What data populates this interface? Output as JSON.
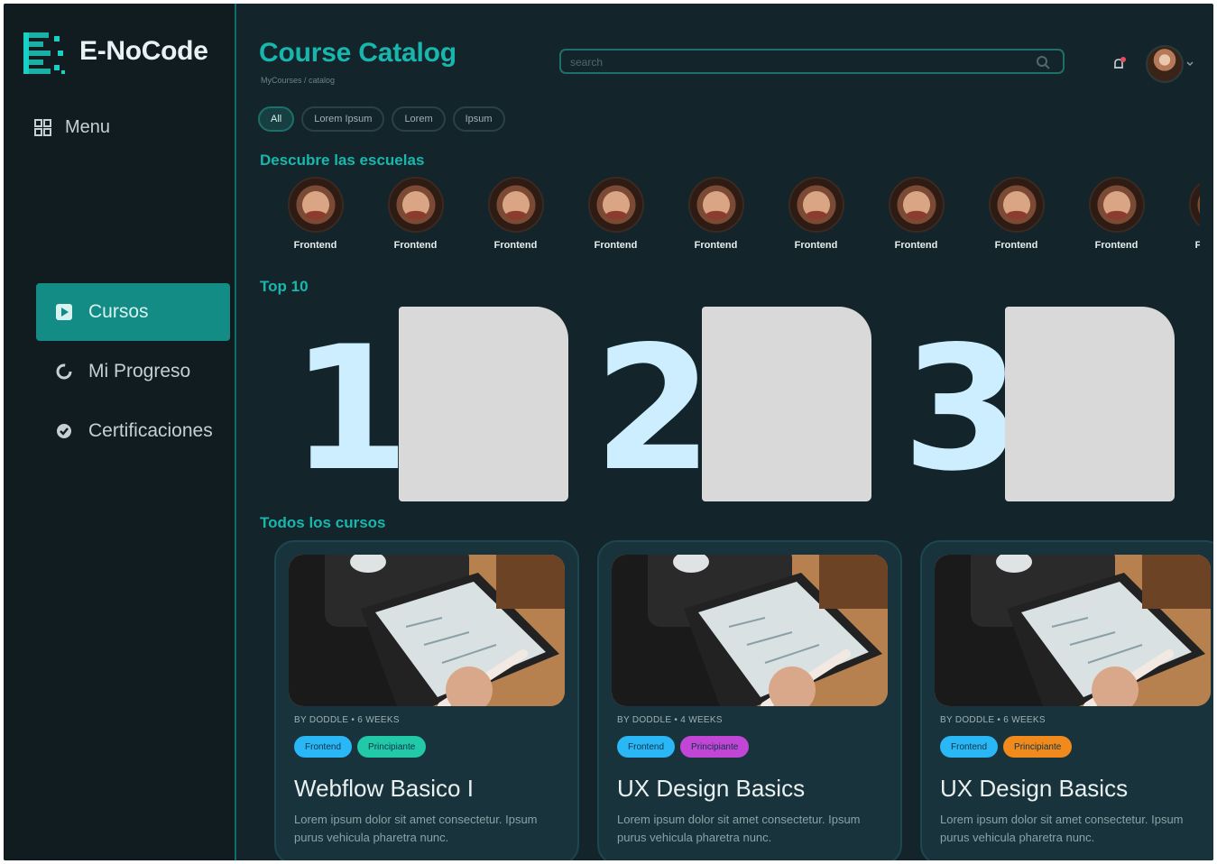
{
  "app": {
    "name": "E-NoCode"
  },
  "sidebar": {
    "menu_label": "Menu",
    "items": [
      {
        "label": "Cursos",
        "icon": "play-square-icon",
        "active": true
      },
      {
        "label": "Mi Progreso",
        "icon": "progress-circle-icon",
        "active": false
      },
      {
        "label": "Certificaciones",
        "icon": "badge-check-icon",
        "active": false
      }
    ]
  },
  "header": {
    "title": "Course Catalog",
    "breadcrumb": "MyCourses / catalog",
    "search_placeholder": "search"
  },
  "filters": [
    "All",
    "Lorem Ipsum",
    "Lorem",
    "Ipsum"
  ],
  "schools": {
    "title": "Descubre las escuelas",
    "items": [
      "Frontend",
      "Frontend",
      "Frontend",
      "Frontend",
      "Frontend",
      "Frontend",
      "Frontend",
      "Frontend",
      "Frontend",
      "Frontend"
    ]
  },
  "top10": {
    "title": "Top 10",
    "ranks": [
      "1",
      "2",
      "3"
    ]
  },
  "courses": {
    "title": "Todos los cursos",
    "items": [
      {
        "meta": "BY DODDLE  •  6 WEEKS",
        "tags": [
          {
            "label": "Frontend",
            "color": "#2ab7f5"
          },
          {
            "label": "Principiante",
            "color": "#21c9a8"
          }
        ],
        "title": "Webflow Basico I",
        "description": "Lorem ipsum dolor sit amet consectetur. Ipsum purus vehicula pharetra nunc."
      },
      {
        "meta": "BY DODDLE  •  4 WEEKS",
        "tags": [
          {
            "label": "Frontend",
            "color": "#2ab7f5"
          },
          {
            "label": "Principiante",
            "color": "#c246d6"
          }
        ],
        "title": "UX Design Basics",
        "description": "Lorem ipsum dolor sit amet consectetur. Ipsum purus vehicula pharetra nunc."
      },
      {
        "meta": "BY DODDLE  •  6 WEEKS",
        "tags": [
          {
            "label": "Frontend",
            "color": "#2ab7f5"
          },
          {
            "label": "Principiante",
            "color": "#f08a1c"
          }
        ],
        "title": "UX Design Basics",
        "description": "Lorem ipsum dolor sit amet consectetur. Ipsum purus vehicula pharetra nunc."
      }
    ]
  },
  "colors": {
    "accent": "#18b7ae",
    "active_nav": "#128c84",
    "rank_number": "#cdeeff"
  }
}
